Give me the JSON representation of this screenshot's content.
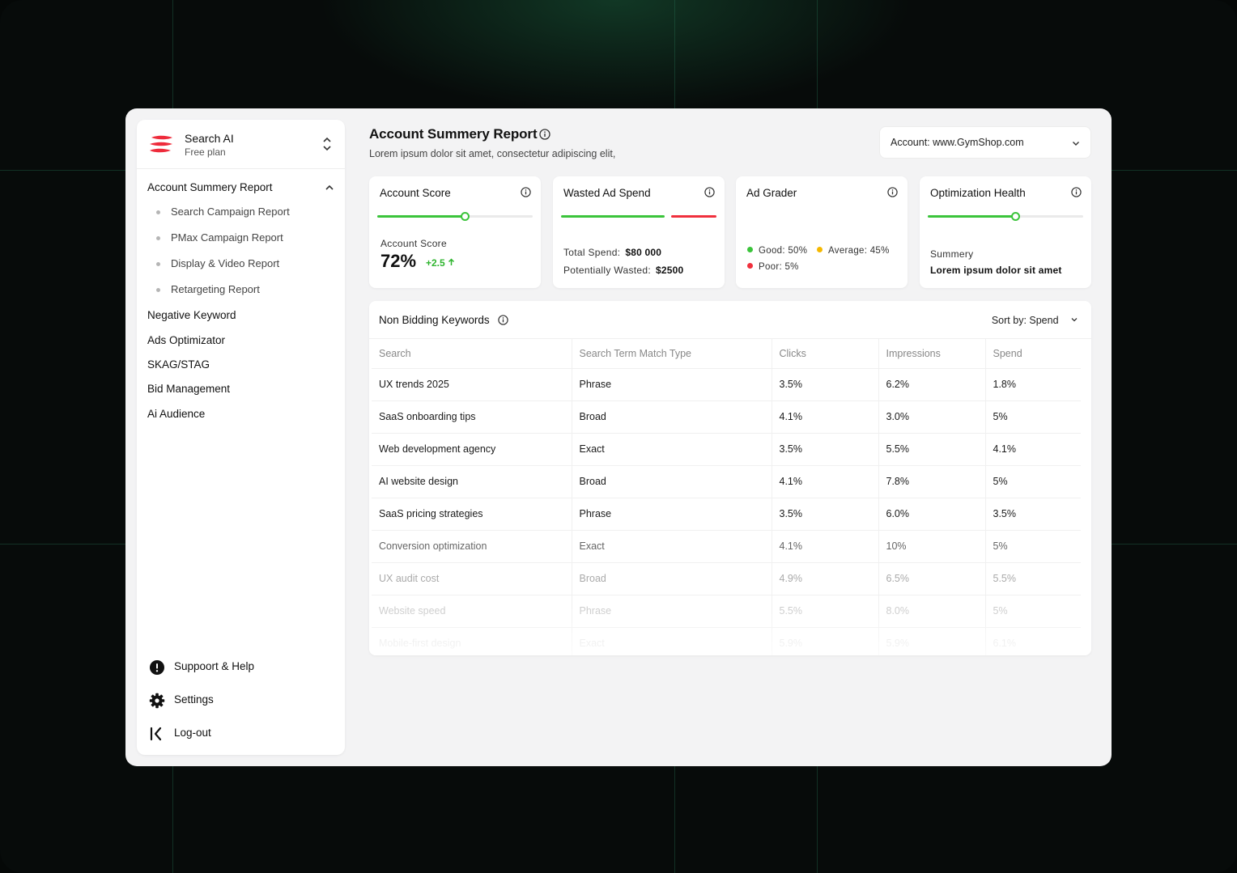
{
  "brand": {
    "name": "Search AI",
    "plan": "Free plan"
  },
  "sidebar": {
    "group_label": "Account Summery Report",
    "sub_items": [
      {
        "label": "Search Campaign Report"
      },
      {
        "label": "PMax Campaign Report"
      },
      {
        "label": "Display & Video Report"
      },
      {
        "label": "Retargeting Report"
      }
    ],
    "items": [
      {
        "label": "Negative Keyword"
      },
      {
        "label": "Ads Optimizator"
      },
      {
        "label": "SKAG/STAG"
      },
      {
        "label": "Bid Management"
      },
      {
        "label": "Ai Audience"
      }
    ],
    "footer": [
      {
        "label": "Suppoort & Help",
        "icon": "alert-circle-icon"
      },
      {
        "label": "Settings",
        "icon": "gear-icon"
      },
      {
        "label": "Log-out",
        "icon": "logout-icon"
      }
    ]
  },
  "header": {
    "title": "Account Summery Report",
    "subtitle": "Lorem ipsum dolor sit amet, consectetur adipiscing elit,",
    "account_select": "Account: www.GymShop.com"
  },
  "cards": {
    "account_score": {
      "title": "Account Score",
      "progress": 0.56,
      "label": "Account Score",
      "value": "72%",
      "delta": "+2.5"
    },
    "wasted": {
      "title": "Wasted Ad Spend",
      "total_label": "Total Spend:",
      "total_value": "$80 000",
      "wasted_label": "Potentially Wasted:",
      "wasted_value": "$2500"
    },
    "grader": {
      "title": "Ad Grader",
      "good": "Good: 50%",
      "average": "Average: 45%",
      "poor": "Poor: 5%"
    },
    "health": {
      "title": "Optimization Health",
      "progress": 0.56,
      "label": "Summery",
      "value": "Lorem ipsum dolor sit amet"
    }
  },
  "colors": {
    "green": "#3bc43b",
    "red": "#f0303d",
    "yellow": "#f5b800",
    "brand_red": "#ee2b3b"
  },
  "table": {
    "title": "Non Bidding Keywords",
    "sort_label": "Sort by: Spend",
    "headers": [
      "Search",
      "Search Term Match Type",
      "Clicks",
      "Impressions",
      "Spend"
    ],
    "rows": [
      [
        "UX trends 2025",
        "Phrase",
        "3.5%",
        "6.2%",
        "1.8%"
      ],
      [
        "SaaS onboarding tips",
        "Broad",
        "4.1%",
        "3.0%",
        "5%"
      ],
      [
        "Web development agency",
        "Exact",
        "3.5%",
        "5.5%",
        "4.1%"
      ],
      [
        "AI website design",
        "Broad",
        "4.1%",
        "7.8%",
        "5%"
      ],
      [
        "SaaS pricing strategies",
        "Phrase",
        "3.5%",
        "6.0%",
        "3.5%"
      ],
      [
        "Conversion optimization",
        "Exact",
        "4.1%",
        "10%",
        "5%"
      ],
      [
        "UX audit cost",
        "Broad",
        "4.9%",
        "6.5%",
        "5.5%"
      ],
      [
        "Website speed",
        "Phrase",
        "5.5%",
        "8.0%",
        "5%"
      ],
      [
        "Mobile-first design",
        "Exact",
        "5.9%",
        "5.9%",
        "6.1%"
      ]
    ]
  }
}
